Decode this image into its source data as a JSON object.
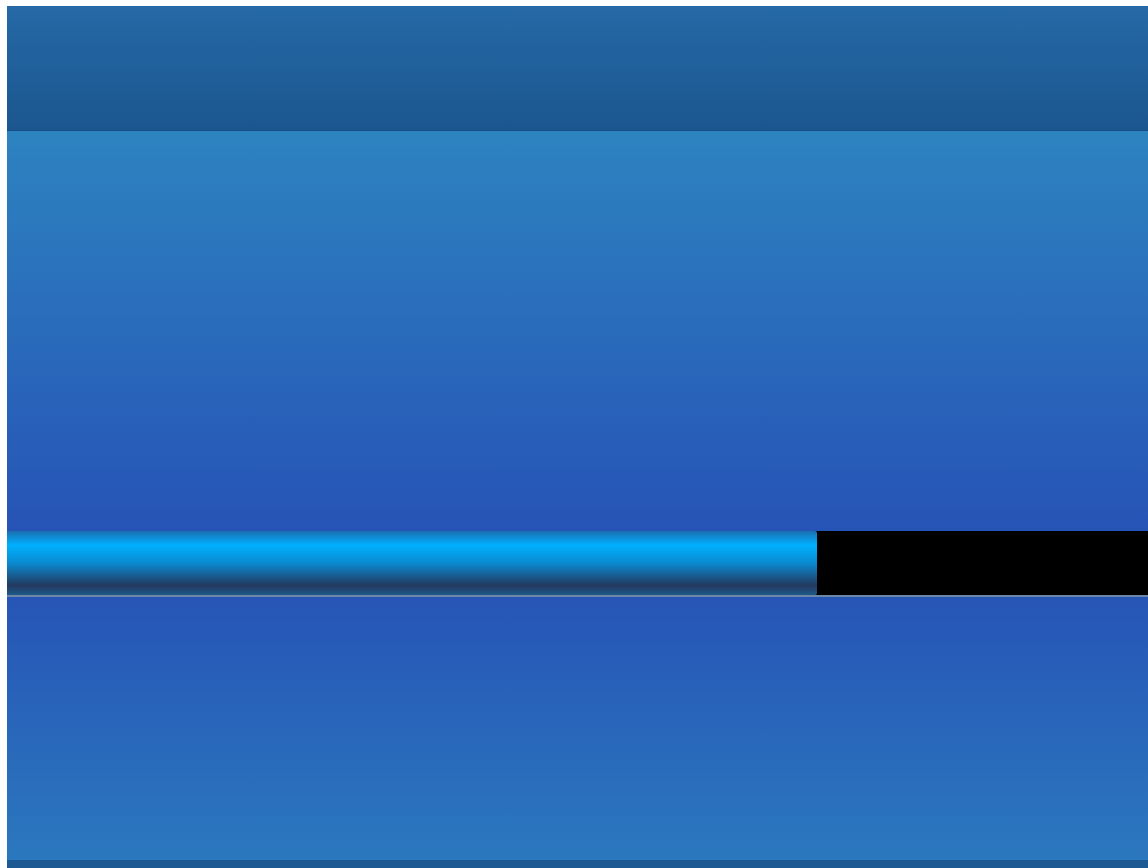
{
  "progress_bar": {
    "level": 0.71
  }
}
